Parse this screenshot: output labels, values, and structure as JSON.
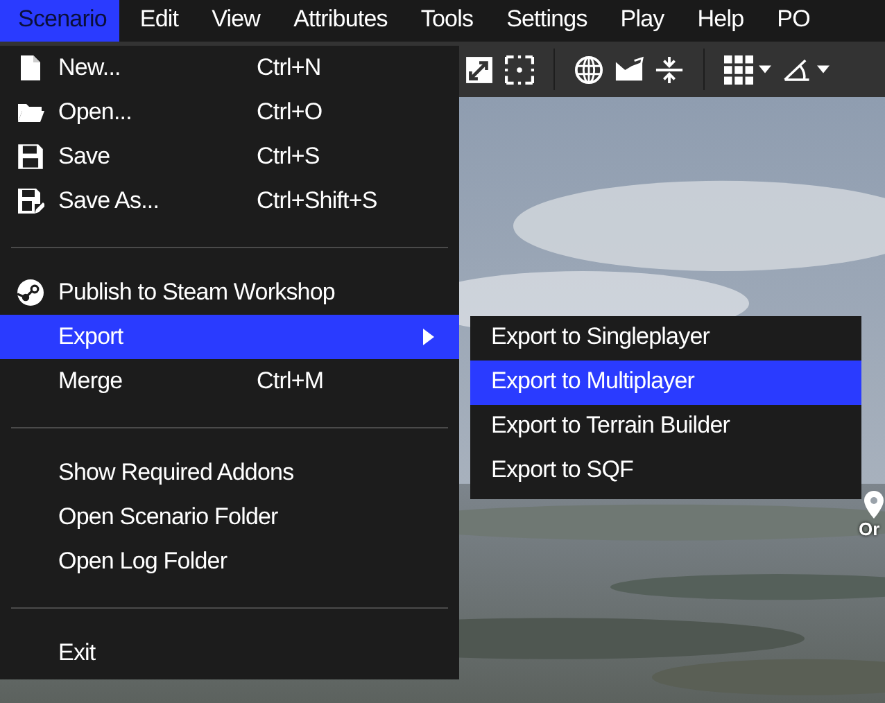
{
  "menubar": [
    {
      "label": "Scenario",
      "selected": true
    },
    {
      "label": "Edit",
      "selected": false
    },
    {
      "label": "View",
      "selected": false
    },
    {
      "label": "Attributes",
      "selected": false
    },
    {
      "label": "Tools",
      "selected": false
    },
    {
      "label": "Settings",
      "selected": false
    },
    {
      "label": "Play",
      "selected": false
    },
    {
      "label": "Help",
      "selected": false
    },
    {
      "label": "PO",
      "selected": false
    }
  ],
  "menu": [
    {
      "kind": "item",
      "label": "New...",
      "shortcut": "Ctrl+N",
      "selected": false
    },
    {
      "kind": "item",
      "label": "Open...",
      "shortcut": "Ctrl+O",
      "selected": false
    },
    {
      "kind": "item",
      "label": "Save",
      "shortcut": "Ctrl+S",
      "selected": false
    },
    {
      "kind": "item",
      "label": "Save As...",
      "shortcut": "Ctrl+Shift+S",
      "selected": false
    },
    {
      "kind": "separator"
    },
    {
      "kind": "item",
      "label": "Publish to Steam Workshop",
      "selected": false
    },
    {
      "kind": "submenu",
      "label": "Export",
      "selected": true
    },
    {
      "kind": "item",
      "label": "Merge",
      "shortcut": "Ctrl+M",
      "selected": false
    },
    {
      "kind": "separator"
    },
    {
      "kind": "item",
      "label": "Show Required Addons",
      "selected": false
    },
    {
      "kind": "item",
      "label": "Open Scenario Folder",
      "selected": false
    },
    {
      "kind": "item",
      "label": "Open Log Folder",
      "selected": false
    },
    {
      "kind": "separator"
    },
    {
      "kind": "item",
      "label": "Exit",
      "selected": false
    }
  ],
  "submenu": [
    {
      "label": "Export to Singleplayer",
      "selected": false
    },
    {
      "label": "Export to Multiplayer",
      "selected": true
    },
    {
      "label": "Export to Terrain Builder",
      "selected": false
    },
    {
      "label": "Export to SQF",
      "selected": false
    }
  ],
  "map_marker": {
    "label": "Or"
  }
}
